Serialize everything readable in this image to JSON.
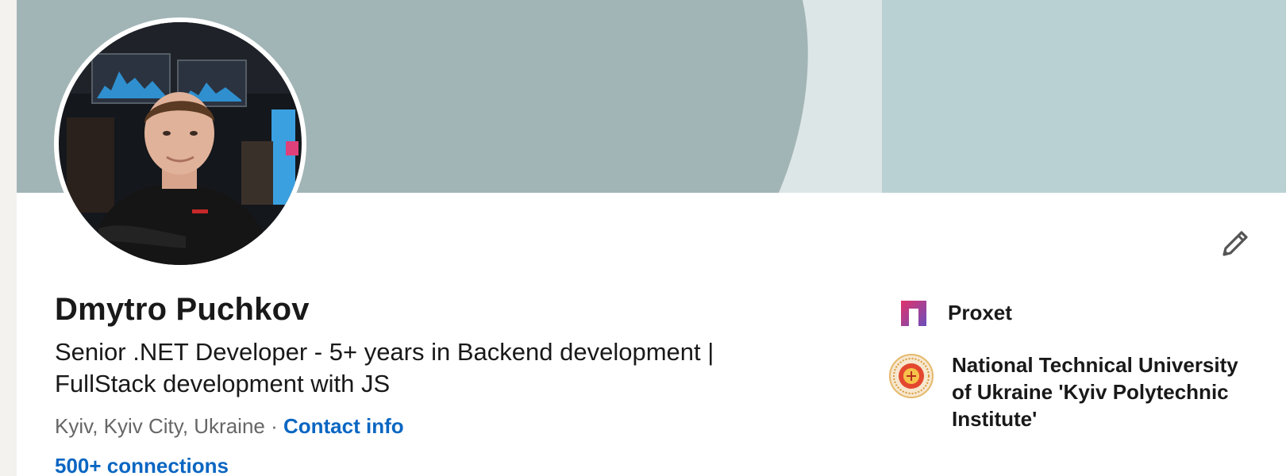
{
  "profile": {
    "name": "Dmytro Puchkov",
    "headline": "Senior .NET Developer - 5+ years in Backend development | FullStack development with JS",
    "location": "Kyiv, Kyiv City, Ukraine",
    "separator": " · ",
    "contact_info_label": "Contact info",
    "connections_label": "500+ connections"
  },
  "sidebar": {
    "company": {
      "label": "Proxet",
      "icon": "proxet-logo-icon"
    },
    "school": {
      "label": "National Technical University of Ukraine 'Kyiv Polytechnic Institute'",
      "icon": "kpi-seal-icon"
    }
  },
  "icons": {
    "edit": "pencil-icon"
  },
  "colors": {
    "link": "#0a66c2",
    "banner_left": "#a2b5b6",
    "banner_right": "#bad1d3",
    "banner_gap": "#dde6e7"
  }
}
